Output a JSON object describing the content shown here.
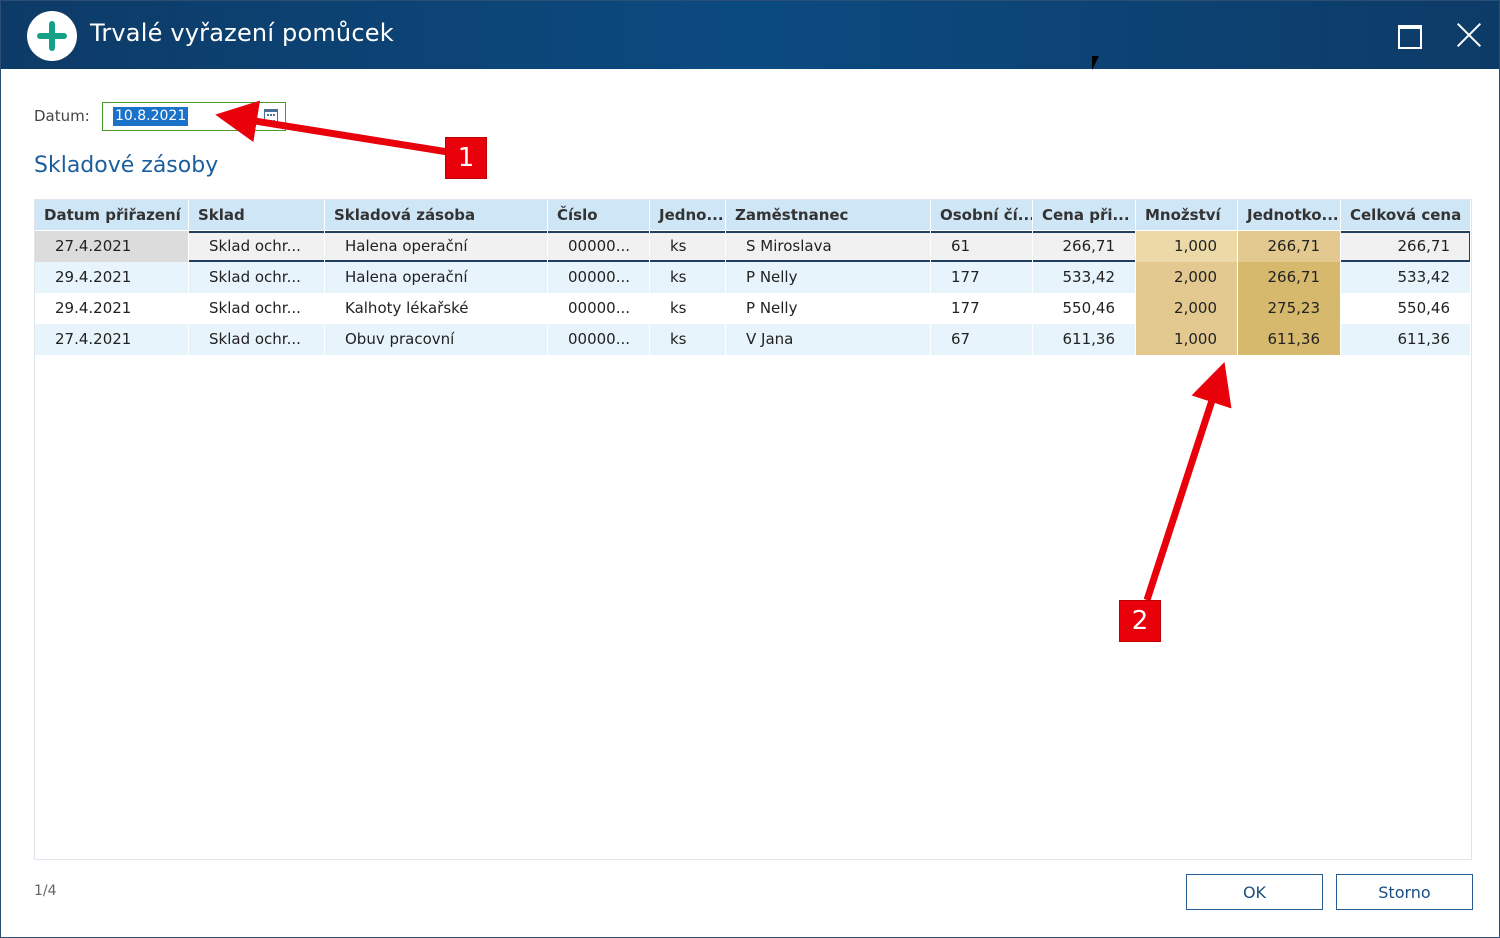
{
  "window": {
    "title": "Trvalé vyřazení pomůcek"
  },
  "form": {
    "date_label": "Datum:",
    "date_value": "10.8.2021"
  },
  "section": {
    "title": "Skladové zásoby"
  },
  "table": {
    "columns": [
      "Datum přiřazení",
      "Sklad",
      "Skladová zásoba",
      "Číslo",
      "Jedno...",
      "Zaměstnanec",
      "Osobní čí...",
      "Cena při...",
      "Množství",
      "Jednotko...",
      "Celková cena"
    ],
    "rows": [
      {
        "datum": "27.4.2021",
        "sklad": "Sklad ochr...",
        "zasoba": "Halena operační",
        "cislo": "00000...",
        "jednotka": "ks",
        "zamestnanec": "S Miroslava",
        "osobni": "61",
        "cena": "266,71",
        "mnozstvi": "1,000",
        "jednotkova": "266,71",
        "celkova": "266,71"
      },
      {
        "datum": "29.4.2021",
        "sklad": "Sklad ochr...",
        "zasoba": "Halena operační",
        "cislo": "00000...",
        "jednotka": "ks",
        "zamestnanec": "P Nelly",
        "osobni": "177",
        "cena": "533,42",
        "mnozstvi": "2,000",
        "jednotkova": "266,71",
        "celkova": "533,42"
      },
      {
        "datum": "29.4.2021",
        "sklad": "Sklad ochr...",
        "zasoba": "Kalhoty lékařské",
        "cislo": "00000...",
        "jednotka": "ks",
        "zamestnanec": "P Nelly",
        "osobni": "177",
        "cena": "550,46",
        "mnozstvi": "2,000",
        "jednotkova": "275,23",
        "celkova": "550,46"
      },
      {
        "datum": "27.4.2021",
        "sklad": "Sklad ochr...",
        "zasoba": "Obuv pracovní",
        "cislo": "00000...",
        "jednotka": "ks",
        "zamestnanec": "V Jana",
        "osobni": "67",
        "cena": "611,36",
        "mnozstvi": "1,000",
        "jednotkova": "611,36",
        "celkova": "611,36"
      }
    ]
  },
  "footer": {
    "pager": "1/4",
    "ok_label": "OK",
    "cancel_label": "Storno"
  },
  "annotations": {
    "badge1": "1",
    "badge2": "2",
    "color": "#e8000b"
  },
  "colors": {
    "titlebar": "#0d3b67",
    "header_bg": "#cfe6f6",
    "accent": "#1b5e9e",
    "qty_highlight": "#e3c98f"
  }
}
